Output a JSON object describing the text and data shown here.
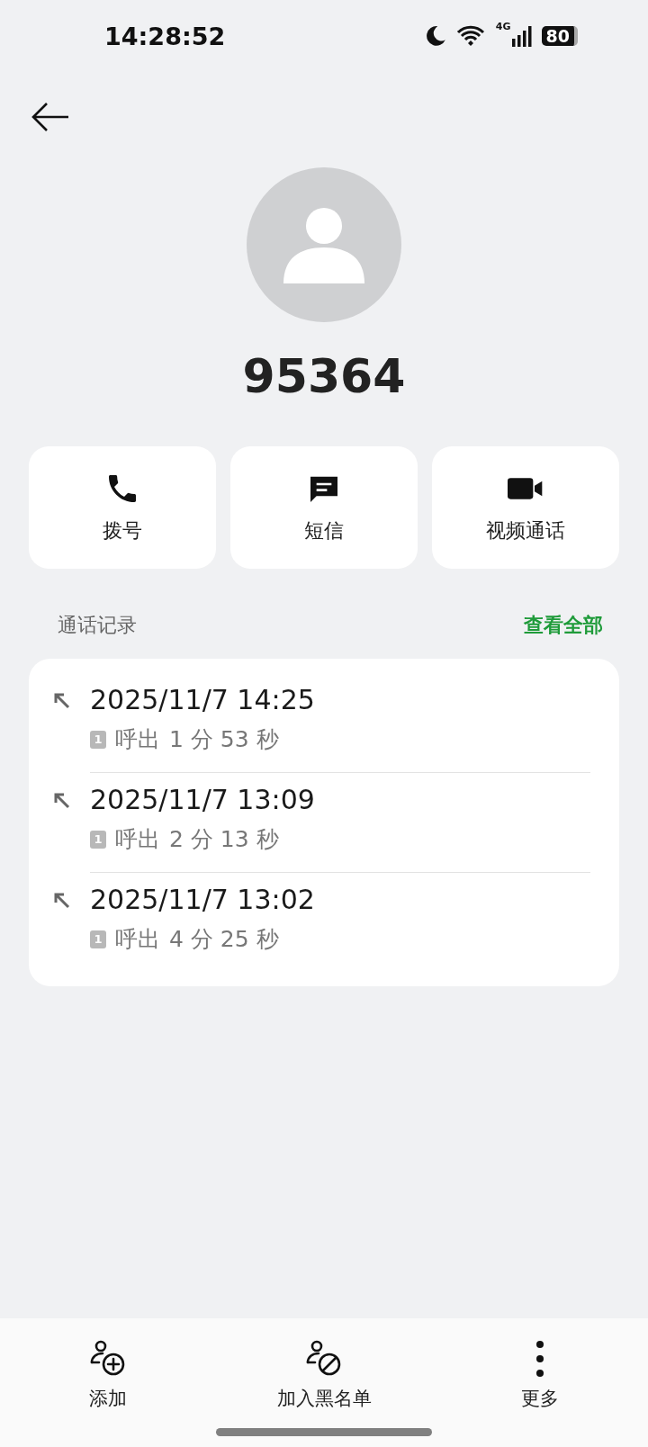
{
  "status_bar": {
    "time": "14:28:52",
    "network": "4G",
    "battery": "80"
  },
  "contact": {
    "name": "95364"
  },
  "actions": [
    {
      "kind": "call",
      "label": "拨号"
    },
    {
      "kind": "message",
      "label": "短信"
    },
    {
      "kind": "video",
      "label": "视频通话"
    }
  ],
  "call_log": {
    "title": "通话记录",
    "view_all": "查看全部",
    "entries": [
      {
        "kind": "outgoing",
        "time": "2025/11/7 14:25",
        "sim": "1",
        "direction": "呼出",
        "duration": "1 分 53 秒"
      },
      {
        "kind": "outgoing",
        "time": "2025/11/7 13:09",
        "sim": "1",
        "direction": "呼出",
        "duration": "2 分 13 秒"
      },
      {
        "kind": "outgoing",
        "time": "2025/11/7 13:02",
        "sim": "1",
        "direction": "呼出",
        "duration": "4 分 25 秒"
      }
    ]
  },
  "bottom_bar": [
    {
      "kind": "add",
      "label": "添加"
    },
    {
      "kind": "block",
      "label": "加入黑名单"
    },
    {
      "kind": "more",
      "label": "更多"
    }
  ]
}
